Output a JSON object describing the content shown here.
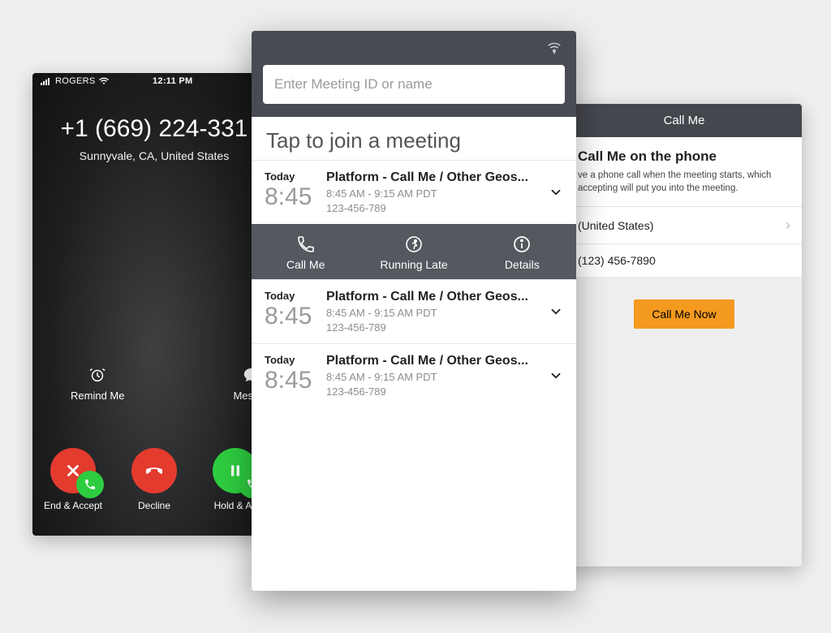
{
  "left": {
    "carrier": "ROGERS",
    "clock": "12:11 PM",
    "phone_number": "+1 (669) 224-331",
    "location": "Sunnyvale, CA, United States",
    "remind_label": "Remind Me",
    "message_label": "Messag",
    "end_accept_label": "End & Accept",
    "decline_label": "Decline",
    "hold_accept_label": "Hold & Ac"
  },
  "center": {
    "search_placeholder": "Enter Meeting ID or name",
    "heading": "Tap to join a meeting",
    "actions": {
      "call_me": "Call Me",
      "running_late": "Running Late",
      "details": "Details"
    },
    "meetings": [
      {
        "day": "Today",
        "time": "8:45",
        "title": "Platform - Call Me / Other Geos...",
        "subtitle": "8:45 AM - 9:15 AM PDT",
        "id": "123-456-789"
      },
      {
        "day": "Today",
        "time": "8:45",
        "title": "Platform - Call Me / Other Geos...",
        "subtitle": "8:45 AM - 9:15 AM PDT",
        "id": "123-456-789"
      },
      {
        "day": "Today",
        "time": "8:45",
        "title": "Platform - Call Me / Other Geos...",
        "subtitle": "8:45 AM - 9:15 AM PDT",
        "id": "123-456-789"
      }
    ]
  },
  "right": {
    "header": "Call Me",
    "title": "Call Me on the phone",
    "description_line1": "ve a phone call when the meeting starts, which",
    "description_line2": "accepting will put you into the meeting.",
    "country": "(United States)",
    "number": "(123) 456-7890",
    "button": "Call Me Now"
  }
}
